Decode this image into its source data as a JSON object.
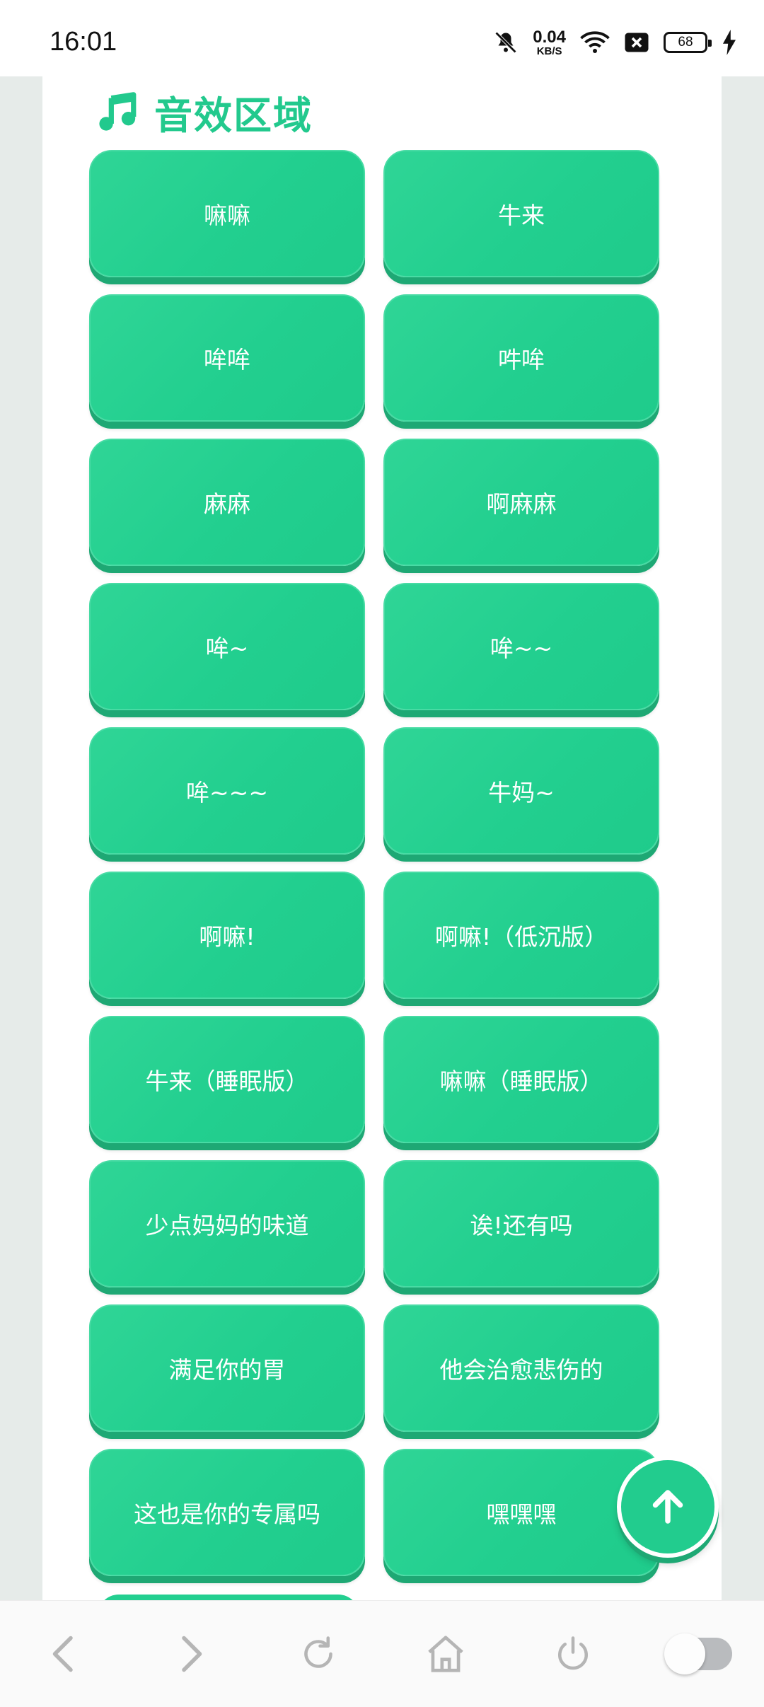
{
  "status_bar": {
    "time": "16:01",
    "net_speed_value": "0.04",
    "net_speed_unit": "KB/S",
    "battery": "68",
    "icons": [
      "mute-bell-icon",
      "wifi-icon",
      "sim-x-icon",
      "battery-icon",
      "charging-icon"
    ]
  },
  "section": {
    "title": "音效区域",
    "icon": "music-note-icon",
    "accent": "#22c98d"
  },
  "buttons": [
    "嘛嘛",
    "牛来",
    "哞哞",
    "吽哞",
    "麻麻",
    "啊麻麻",
    "哞~",
    "哞~~",
    "哞~~~",
    "牛妈~",
    "啊嘛!",
    "啊嘛!（低沉版）",
    "牛来（睡眠版）",
    "嘛嘛（睡眠版）",
    "少点妈妈的味道",
    "诶!还有吗",
    "满足你的胃",
    "他会治愈悲伤的",
    "这也是你的专属吗",
    "嘿嘿嘿"
  ],
  "fab": {
    "icon": "arrow-up-icon"
  },
  "bottom_nav": [
    "back-icon",
    "forward-icon",
    "refresh-icon",
    "home-icon",
    "power-icon",
    "toggle-switch"
  ],
  "colors": {
    "button": "#22cf8f",
    "button_shadow": "#1ea874",
    "background": "#e6ebe9"
  }
}
